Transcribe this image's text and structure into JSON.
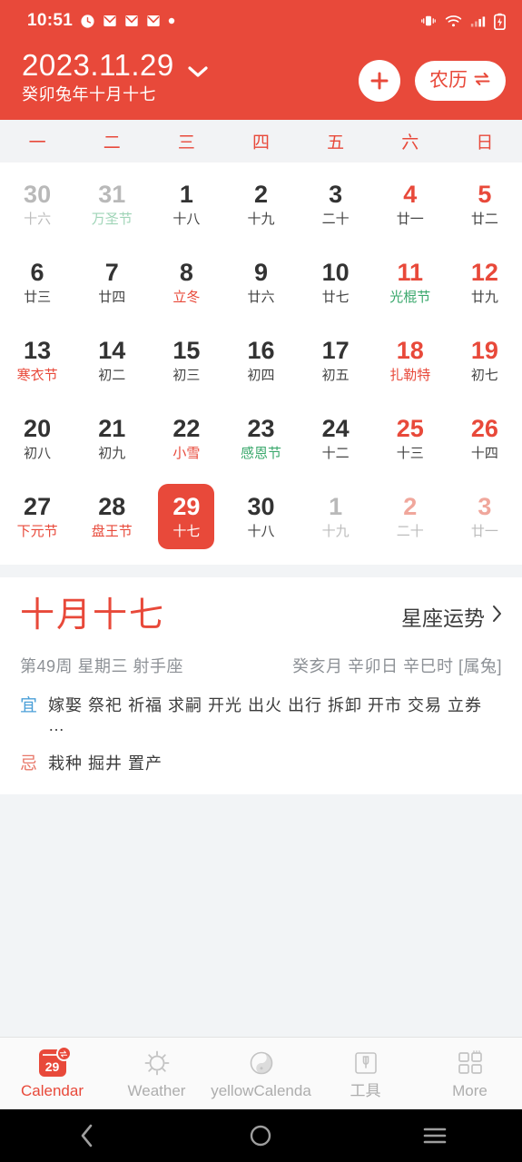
{
  "statusbar": {
    "time": "10:51",
    "icons_left": [
      "clock-icon",
      "mail-icon",
      "mail-icon",
      "mail-icon",
      "dot-icon"
    ],
    "icons_right": [
      "vibrate-icon",
      "wifi-icon",
      "signal-icon",
      "battery-charging-icon"
    ]
  },
  "header": {
    "solar_date": "2023.11.29",
    "lunar_date": "癸卯兔年十月十七",
    "chevron_icon": "chevron-down-icon",
    "add_label": "+",
    "toggle_label": "农历",
    "toggle_icon": "swap-icon",
    "bg_color": "#e8493a"
  },
  "weekdays": [
    "一",
    "二",
    "三",
    "四",
    "五",
    "六",
    "日"
  ],
  "calendar": {
    "selected_day": "29",
    "selected_lunar": "十七",
    "rows": [
      [
        {
          "day": "30",
          "sub": "十六",
          "out": true
        },
        {
          "day": "31",
          "sub": "万圣节",
          "out": true,
          "sub_color": "green"
        },
        {
          "day": "1",
          "sub": "十八"
        },
        {
          "day": "2",
          "sub": "十九"
        },
        {
          "day": "3",
          "sub": "二十"
        },
        {
          "day": "4",
          "sub": "廿一",
          "weekend": true
        },
        {
          "day": "5",
          "sub": "廿二",
          "weekend": true
        }
      ],
      [
        {
          "day": "6",
          "sub": "廿三"
        },
        {
          "day": "7",
          "sub": "廿四"
        },
        {
          "day": "8",
          "sub": "立冬",
          "sub_color": "red"
        },
        {
          "day": "9",
          "sub": "廿六"
        },
        {
          "day": "10",
          "sub": "廿七"
        },
        {
          "day": "11",
          "sub": "光棍节",
          "weekend": true,
          "sub_color": "green"
        },
        {
          "day": "12",
          "sub": "廿九",
          "weekend": true
        }
      ],
      [
        {
          "day": "13",
          "sub": "寒衣节",
          "sub_color": "red"
        },
        {
          "day": "14",
          "sub": "初二"
        },
        {
          "day": "15",
          "sub": "初三"
        },
        {
          "day": "16",
          "sub": "初四"
        },
        {
          "day": "17",
          "sub": "初五"
        },
        {
          "day": "18",
          "sub": "扎勒特",
          "weekend": true,
          "sub_color": "red"
        },
        {
          "day": "19",
          "sub": "初七",
          "weekend": true
        }
      ],
      [
        {
          "day": "20",
          "sub": "初八"
        },
        {
          "day": "21",
          "sub": "初九"
        },
        {
          "day": "22",
          "sub": "小雪",
          "sub_color": "red"
        },
        {
          "day": "23",
          "sub": "感恩节",
          "sub_color": "green"
        },
        {
          "day": "24",
          "sub": "十二"
        },
        {
          "day": "25",
          "sub": "十三",
          "weekend": true
        },
        {
          "day": "26",
          "sub": "十四",
          "weekend": true
        }
      ],
      [
        {
          "day": "27",
          "sub": "下元节",
          "sub_color": "red"
        },
        {
          "day": "28",
          "sub": "盘王节",
          "sub_color": "red"
        },
        {
          "day": "29",
          "sub": "十七",
          "selected": true
        },
        {
          "day": "30",
          "sub": "十八"
        },
        {
          "day": "1",
          "sub": "十九",
          "out": true
        },
        {
          "day": "2",
          "sub": "二十",
          "out": true,
          "weekend": true
        },
        {
          "day": "3",
          "sub": "廿一",
          "out": true,
          "weekend": true
        }
      ]
    ]
  },
  "detail": {
    "lunar_title": "十月十七",
    "horoscope_label": "星座运势",
    "horoscope_icon": "chevron-right-icon",
    "meta_left": "第49周  星期三  射手座",
    "meta_right": "癸亥月 辛卯日 辛巳时 [属兔]",
    "yi_tag": "宜",
    "yi_items": "嫁娶 祭祀 祈福 求嗣 开光 出火 出行 拆卸 开市 交易 立券 …",
    "ji_tag": "忌",
    "ji_items": "栽种 掘井 置产"
  },
  "tabbar": {
    "items": [
      {
        "label": "Calendar",
        "icon": "calendar-icon",
        "badge": "29",
        "badge_icon": "swap-icon",
        "active": true
      },
      {
        "label": "Weather",
        "icon": "sun-icon",
        "active": false
      },
      {
        "label": "yellowCalenda",
        "icon": "yinyang-icon",
        "active": false
      },
      {
        "label": "工具",
        "icon": "tools-icon",
        "active": false
      },
      {
        "label": "More",
        "icon": "grid-icon",
        "active": false
      }
    ]
  },
  "navbar": {
    "back_icon": "back-icon",
    "home_icon": "home-circle-icon",
    "menu_icon": "menu-icon"
  }
}
